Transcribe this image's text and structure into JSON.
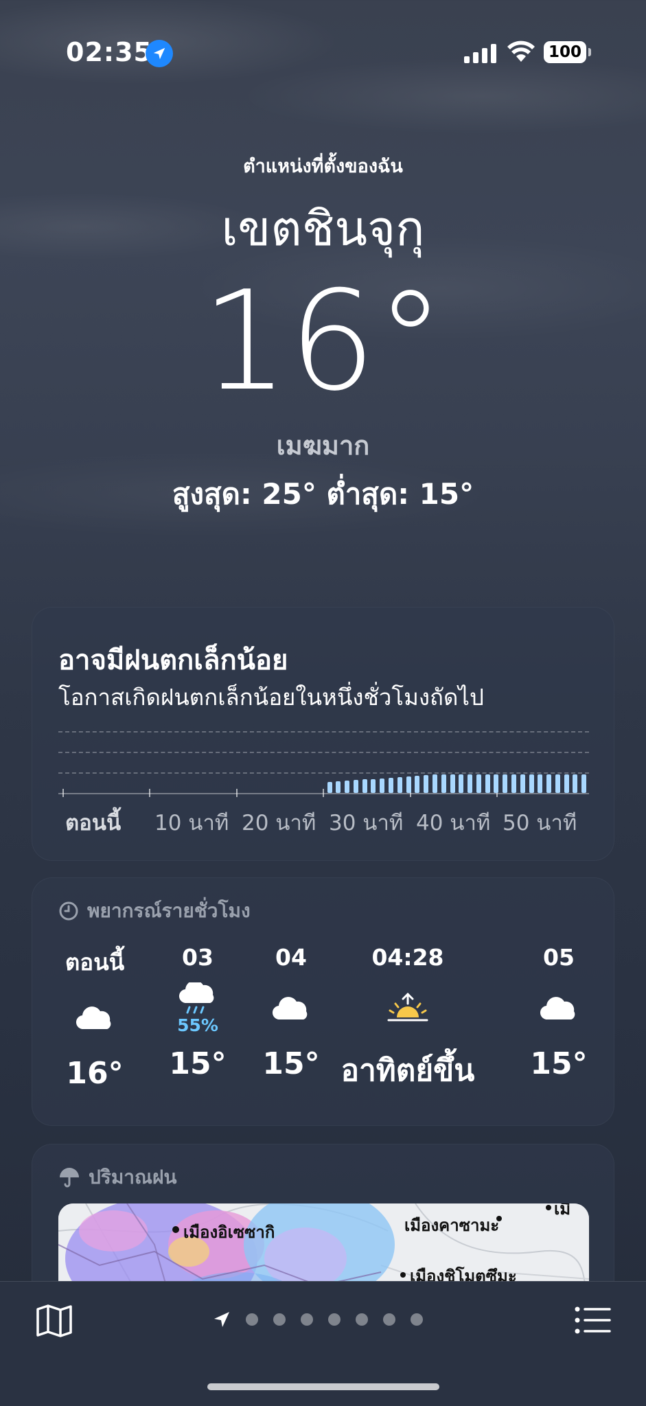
{
  "status_bar": {
    "time": "02:35",
    "battery": "100"
  },
  "header": {
    "my_location": "ตำแหน่งที่ตั้งของฉัน",
    "city": "เขตชินจุกุ",
    "temperature": "16°",
    "condition": "เมฆมาก",
    "high_low": "สูงสุด: 25°  ต่ำสุด: 15°"
  },
  "rain_card": {
    "title": "อาจมีฝนตกเล็กน้อย",
    "subtitle": "โอกาสเกิดฝนตกเล็กน้อยในหนึ่งชั่วโมงถัดไป",
    "labels": [
      "ตอนนี้",
      "10 นาที",
      "20 นาที",
      "30 นาที",
      "40 นาที",
      "50 นาที"
    ],
    "intensity_by_minute_start": 30,
    "bar_color": "#a9d8ff"
  },
  "hourly": {
    "header": "พยากรณ์รายชั่วโมง",
    "items": [
      {
        "time": "ตอนนี้",
        "icon": "cloud-icon",
        "pop": "",
        "temp": "16°"
      },
      {
        "time": "03",
        "icon": "cloud-rain-icon",
        "pop": "55%",
        "temp": "15°"
      },
      {
        "time": "04",
        "icon": "cloud-icon",
        "pop": "",
        "temp": "15°"
      },
      {
        "time": "04:28",
        "icon": "sunrise-icon",
        "pop": "",
        "temp": "อาทิตย์ขึ้น"
      },
      {
        "time": "05",
        "icon": "cloud-icon",
        "pop": "",
        "temp": "15°"
      }
    ]
  },
  "precipitation": {
    "header": "ปริมาณฝน",
    "map_labels": [
      "เมืองอิเซซากิ",
      "เมืองคาซามะ",
      "เมืองชิโมตซึมะ",
      "เมื"
    ]
  },
  "bottom_bar": {
    "page_count": 7,
    "icons": [
      "map-icon",
      "location-arrow-icon",
      "list-icon"
    ]
  },
  "colors": {
    "accent_blue": "#1e88ff",
    "rain_blue": "#6cc8ff",
    "sun_yellow": "#f7c84a"
  }
}
